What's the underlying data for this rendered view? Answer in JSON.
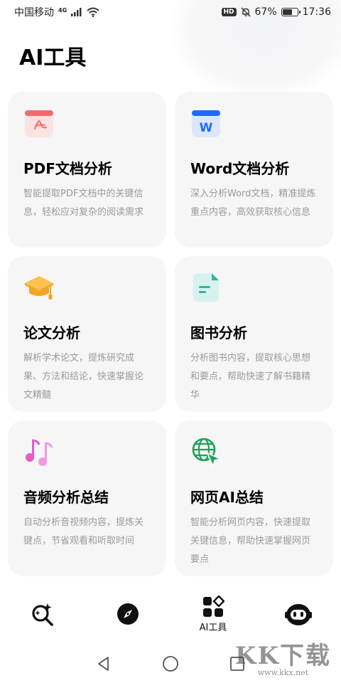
{
  "status_bar": {
    "carrier": "中国移动",
    "signal": "4G",
    "battery": "67%",
    "battery_level": 0.67,
    "time": "17:36",
    "hd": "HD"
  },
  "page": {
    "title": "AI工具"
  },
  "cards": [
    {
      "icon": "pdf-icon",
      "title": "PDF文档分析",
      "desc": "智能提取PDF文档中的关键信息，轻松应对复杂的阅读需求"
    },
    {
      "icon": "word-icon",
      "title": "Word文档分析",
      "desc": "深入分析Word文档，精准提炼重点内容，高效获取核心信息"
    },
    {
      "icon": "graduation-cap-icon",
      "title": "论文分析",
      "desc": "解析学术论文，提炼研究成果、方法和结论，快速掌握论文精髓"
    },
    {
      "icon": "book-doc-icon",
      "title": "图书分析",
      "desc": "分析图书内容，提取核心思想和要点，帮助快速了解书籍精华"
    },
    {
      "icon": "music-note-icon",
      "title": "音频分析总结",
      "desc": "自动分析音视频内容，提炼关键点，节省观看和听取时间"
    },
    {
      "icon": "globe-cursor-icon",
      "title": "网页AI总结",
      "desc": "智能分析网页内容，快速提取关键信息，帮助快速掌握网页要点"
    }
  ],
  "bottom_nav": {
    "items": [
      {
        "icon": "ai-search-icon",
        "label": ""
      },
      {
        "icon": "compass-icon",
        "label": ""
      },
      {
        "icon": "ai-tools-grid-icon",
        "label": "AI工具"
      },
      {
        "icon": "robot-face-icon",
        "label": ""
      }
    ]
  },
  "watermark": {
    "main": "KK下载",
    "url": "www.kkx.net"
  },
  "colors": {
    "card_bg": "#f6f6f7",
    "desc": "#9a9a9a",
    "pdf": "#f26b6b",
    "word": "#1e6bff",
    "cap": "#f5a524",
    "book": "#29b9a6",
    "music": "#e65acb",
    "globe": "#20a05a"
  }
}
